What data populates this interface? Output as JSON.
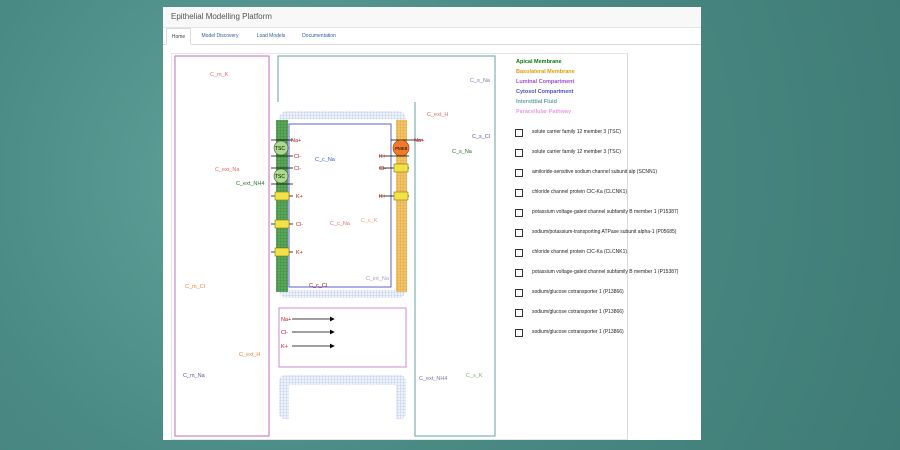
{
  "app": {
    "title": "Epithelial Modelling Platform",
    "tabs": [
      {
        "label": "Home",
        "active": true
      },
      {
        "label": "Model Discovery"
      },
      {
        "label": "Load Models"
      },
      {
        "label": "Documentation"
      }
    ]
  },
  "diagram": {
    "outer_labels": {
      "c_m_k": "C_m_K",
      "c_ext_na": "C_ext_Na",
      "c_ext_nh4": "C_ext_NH4",
      "c_m_cl": "C_m_Cl",
      "c_ext_h_bottom": "C_ext_H",
      "c_m_na": "C_m_Na",
      "c_s_na_top": "C_s_Na",
      "c_ext_h_top": "C_ext_H",
      "c_s_cl": "C_s_Cl",
      "c_s_na_right": "C_s_Na",
      "c_ext_nh4_bottom": "C_ext_NH4",
      "c_s_k": "C_s_K"
    },
    "inner_labels": {
      "c_c_na_top": "C_c_Na",
      "c_c_na_mid": "C_c_Na",
      "c_c_k": "C_c_K",
      "c_int_na": "C_int_Na",
      "c_c_cl": "C_c_Cl"
    },
    "apical_ions": [
      "Na+",
      "Cl-",
      "Cl-",
      "K+",
      "Cl-",
      "K+"
    ],
    "apical_transporter_tsc": "TSC",
    "basolateral_ions": [
      "Na+",
      "K+",
      "Cl-",
      "K+"
    ],
    "basolateral_pump": "PMK8",
    "paracellular_ions": [
      "Na+",
      "Cl-",
      "K+"
    ]
  },
  "legend": [
    {
      "label": "Apical Membrane",
      "color": "#0a7a0a"
    },
    {
      "label": "Basolateral Membrane",
      "color": "#e59b00"
    },
    {
      "label": "Luminal Compartment",
      "color": "#a14bd1"
    },
    {
      "label": "Cytosol Compartment",
      "color": "#4f4fd1"
    },
    {
      "label": "Interstitial Fluid",
      "color": "#5fa3a3"
    },
    {
      "label": "Paracellular Pathway",
      "color": "#e89ae8"
    }
  ],
  "proteins": [
    "solute carrier family 12 member 3 (TSC)",
    "solute carrier family 12 member 3 (TSC)",
    "amiloride-sensitive sodium channel subunit alp (SCNN1)",
    "chloride channel protein ClC-Ka (CLCNK1)",
    "potassium voltage-gated channel subfamily B member 1 (P15387)",
    "sodium/potassium-transporting ATPase subunit alpha-1 (P05685)",
    "chloride channel protein ClC-Ka (CLCNK1)",
    "potassium voltage-gated channel subfamily B member 1 (P15387)",
    "sodium/glucose cotransporter 1 (P13866)",
    "sodium/glucose cotransporter 1 (P13866)",
    "sodium/glucose cotransporter 1 (P13866)"
  ]
}
